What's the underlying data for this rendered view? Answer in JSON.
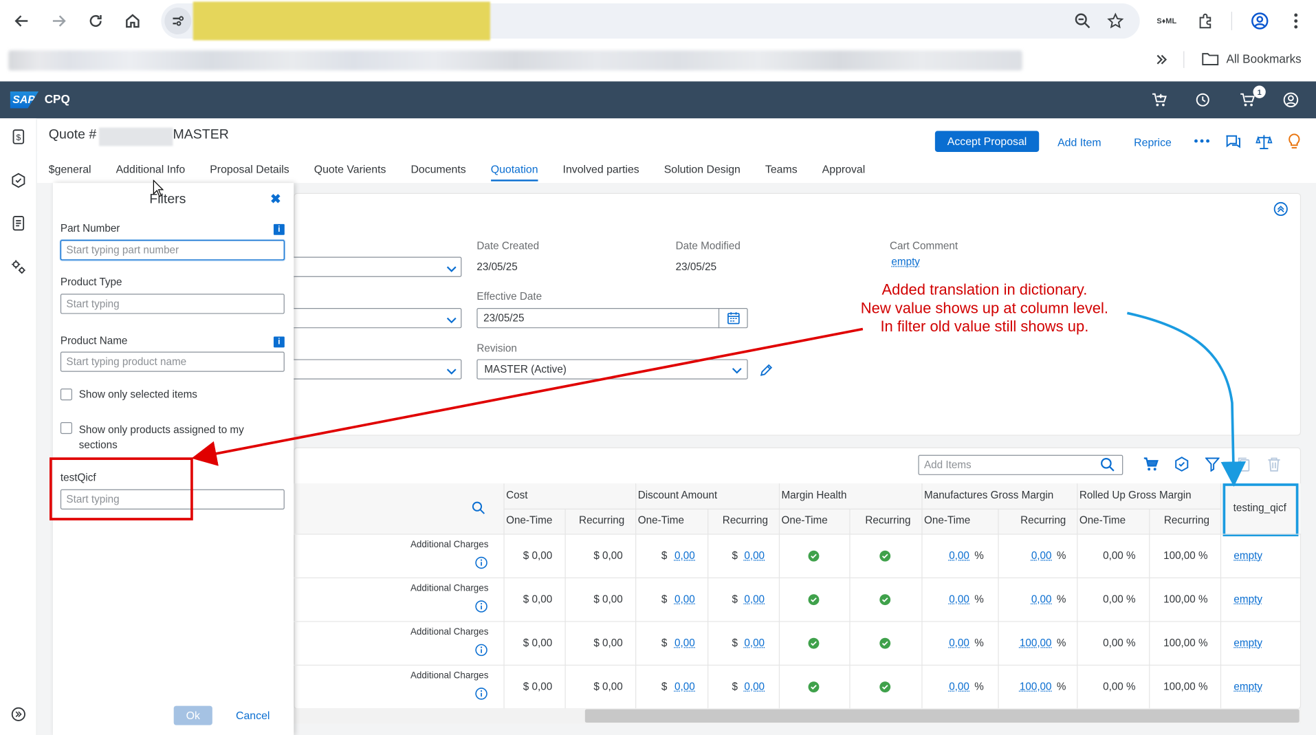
{
  "browser": {
    "bookmarks_label": "All Bookmarks"
  },
  "app": {
    "brand": "SAP",
    "name": "CPQ",
    "cart_badge": "1"
  },
  "quote": {
    "title_prefix": "Quote #",
    "title_suffix": "MASTER",
    "actions": {
      "accept": "Accept Proposal",
      "add_item": "Add Item",
      "reprice": "Reprice"
    }
  },
  "tabs": [
    "$general",
    "Additional Info",
    "Proposal Details",
    "Quote Varients",
    "Documents",
    "Quotation",
    "Involved parties",
    "Solution Design",
    "Teams",
    "Approval"
  ],
  "active_tab": "Quotation",
  "details": {
    "date_created_label": "Date Created",
    "date_created": "23/05/25",
    "date_modified_label": "Date Modified",
    "date_modified": "23/05/25",
    "cart_comment_label": "Cart Comment",
    "cart_comment": "empty",
    "effective_date_label": "Effective Date",
    "effective_date": "23/05/25",
    "revision_label": "Revision",
    "revision": "MASTER (Active)"
  },
  "items_toolbar": {
    "add_items_placeholder": "Add Items"
  },
  "table": {
    "groups": [
      "Cost",
      "Discount Amount",
      "Margin Health",
      "Manufactures Gross Margin",
      "Rolled Up Gross Margin"
    ],
    "sub": [
      "One-Time",
      "Recurring"
    ],
    "custom_column": "testing_qicf",
    "rows": [
      {
        "label": "Additional Charges",
        "cost_ot": "$ 0,00",
        "cost_rec": "$ 0,00",
        "disc_ot": "0,00",
        "disc_rec": "0,00",
        "mgm_ot": "0,00",
        "mgm_rec": "0,00",
        "rgm_ot": "0,00 %",
        "rgm_rec": "100,00 %",
        "custom": "empty"
      },
      {
        "label": "Additional Charges",
        "cost_ot": "$ 0,00",
        "cost_rec": "$ 0,00",
        "disc_ot": "0,00",
        "disc_rec": "0,00",
        "mgm_ot": "0,00",
        "mgm_rec": "0,00",
        "rgm_ot": "0,00 %",
        "rgm_rec": "100,00 %",
        "custom": "empty"
      },
      {
        "label": "Additional Charges",
        "cost_ot": "$ 0,00",
        "cost_rec": "$ 0,00",
        "disc_ot": "0,00",
        "disc_rec": "0,00",
        "mgm_ot": "0,00",
        "mgm_rec": "100,00",
        "rgm_ot": "0,00 %",
        "rgm_rec": "100,00 %",
        "custom": "empty"
      },
      {
        "label": "Additional Charges",
        "cost_ot": "$ 0,00",
        "cost_rec": "$ 0,00",
        "disc_ot": "0,00",
        "disc_rec": "0,00",
        "mgm_ot": "0,00",
        "mgm_rec": "100,00",
        "rgm_ot": "0,00 %",
        "rgm_rec": "100,00 %",
        "custom": "empty"
      }
    ],
    "dollar": "$",
    "percent": "%"
  },
  "filters": {
    "title": "Filters",
    "part_number_label": "Part Number",
    "part_number_placeholder": "Start typing part number",
    "product_type_label": "Product Type",
    "product_type_placeholder": "Start typing",
    "product_name_label": "Product Name",
    "product_name_placeholder": "Start typing product name",
    "show_selected": "Show only selected items",
    "show_assigned": "Show only products assigned to my sections",
    "custom_label": "testQicf",
    "custom_placeholder": "Start typing",
    "ok": "Ok",
    "cancel": "Cancel"
  },
  "annotation": {
    "line1": "Added translation in dictionary.",
    "line2": "New value shows up at column level.",
    "line3": "In filter old value still shows up."
  },
  "colors": {
    "shell": "#354a5f",
    "accent": "#0a6ed1",
    "annotation_red": "#e00000",
    "annotation_blue": "#1a9be0",
    "health_green": "#3fa14b"
  }
}
